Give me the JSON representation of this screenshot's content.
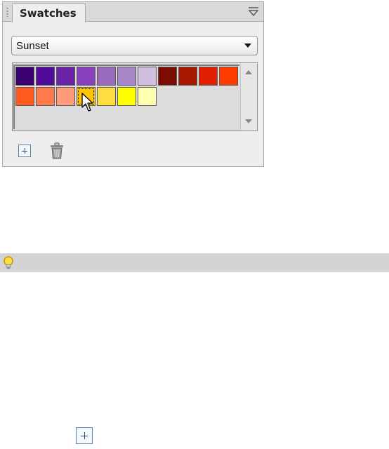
{
  "panel": {
    "tab_label": "Swatches",
    "menu_icon": "panel-menu-icon",
    "preset_select": {
      "value": "Sunset"
    },
    "swatches": [
      {
        "color": "#3a006f"
      },
      {
        "color": "#520a9a"
      },
      {
        "color": "#6a24a8"
      },
      {
        "color": "#8a3fbf"
      },
      {
        "color": "#9b6bbd"
      },
      {
        "color": "#a688c8"
      },
      {
        "color": "#d2bedf"
      },
      {
        "color": "#7a0d00"
      },
      {
        "color": "#a81a00"
      },
      {
        "color": "#e02000"
      },
      {
        "color": "#ff3b00"
      },
      {
        "color": "#ff5a1e"
      },
      {
        "color": "#ff7a4a"
      },
      {
        "color": "#ff9b7a"
      },
      {
        "color": "#ffc400",
        "selected": true
      },
      {
        "color": "#ffdc40"
      },
      {
        "color": "#ffff00"
      },
      {
        "color": "#ffffb0"
      }
    ],
    "footer": {
      "add_icon": "add-swatch-icon",
      "delete_icon": "trash-icon"
    }
  },
  "tip_bar": {
    "icon": "lightbulb-icon"
  },
  "bottom": {
    "add_icon": "add-swatch-icon"
  }
}
